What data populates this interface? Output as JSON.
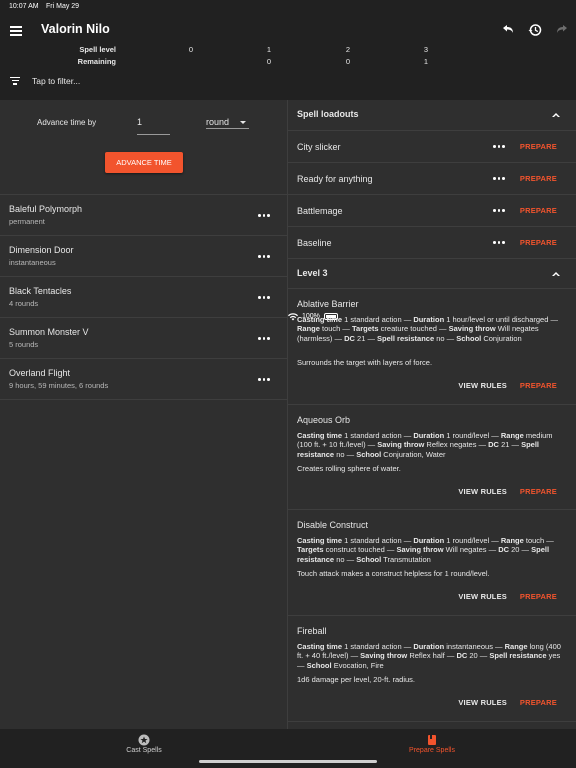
{
  "status": {
    "time": "10:07 AM",
    "date": "Fri May 29",
    "battery": "100%"
  },
  "appbar": {
    "title": "Valorin Nilo",
    "slot_header": "Spell level",
    "remaining_header": "Remaining",
    "levels": [
      "0",
      "1",
      "2",
      "3"
    ],
    "remaining": [
      "",
      "0",
      "0",
      "1"
    ],
    "filter": "Tap to filter..."
  },
  "advance": {
    "label": "Advance time by",
    "value": "1",
    "unit": "round",
    "button": "ADVANCE TIME"
  },
  "effects": [
    {
      "name": "Baleful Polymorph",
      "duration": "permanent"
    },
    {
      "name": "Dimension Door",
      "duration": "instantaneous"
    },
    {
      "name": "Black Tentacles",
      "duration": "4 rounds"
    },
    {
      "name": "Summon Monster V",
      "duration": "5 rounds"
    },
    {
      "name": "Overland Flight",
      "duration": "9 hours, 59 minutes, 6 rounds"
    }
  ],
  "loadouts": {
    "title": "Spell loadouts",
    "prepare": "PREPARE",
    "items": [
      "City slicker",
      "Ready for anything",
      "Battlemage",
      "Baseline"
    ]
  },
  "level3": {
    "title": "Level 3",
    "view_rules": "VIEW RULES",
    "prepare": "PREPARE",
    "spells": [
      {
        "name": "Ablative Barrier",
        "desc": "Surrounds the target with layers of force."
      },
      {
        "name": "Aqueous Orb",
        "desc": "Creates rolling sphere of water."
      },
      {
        "name": "Disable Construct",
        "desc": "Touch attack makes a construct helpless for 1 round/level."
      },
      {
        "name": "Fireball",
        "desc": "1d6 damage per level, 20-ft. radius."
      }
    ]
  },
  "tabs": {
    "cast": "Cast Spells",
    "prepare": "Prepare Spells"
  },
  "colors": {
    "accent": "#f2542d",
    "bar": "#212121",
    "bg": "#2f2f2f"
  }
}
